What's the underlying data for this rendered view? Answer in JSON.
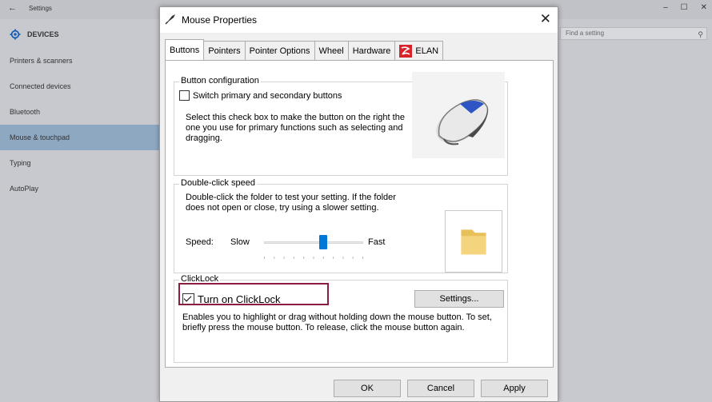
{
  "settings": {
    "title": "Settings",
    "category": "DEVICES",
    "search_placeholder": "Find a setting",
    "sidebar_items": [
      {
        "label": "Printers & scanners"
      },
      {
        "label": "Connected devices"
      },
      {
        "label": "Bluetooth"
      },
      {
        "label": "Mouse & touchpad",
        "active": true
      },
      {
        "label": "Typing"
      },
      {
        "label": "AutoPlay"
      }
    ]
  },
  "dialog": {
    "title": "Mouse Properties",
    "tabs": [
      "Buttons",
      "Pointers",
      "Pointer Options",
      "Wheel",
      "Hardware",
      "ELAN"
    ],
    "selected_tab": "Buttons",
    "button_config": {
      "legend": "Button configuration",
      "checkbox_label": "Switch primary and secondary buttons",
      "checked": false,
      "description": "Select this check box to make the button on the right the one you use for primary functions such as selecting and dragging."
    },
    "double_click": {
      "legend": "Double-click speed",
      "description": "Double-click the folder to test your setting. If the folder does not open or close, try using a slower setting.",
      "speed_label": "Speed:",
      "slow_label": "Slow",
      "fast_label": "Fast",
      "speed_value": 0.6
    },
    "clicklock": {
      "legend": "ClickLock",
      "checkbox_label": "Turn on ClickLock",
      "checked": true,
      "settings_button": "Settings...",
      "description": "Enables you to highlight or drag without holding down the mouse button. To set, briefly press the mouse button. To release, click the mouse button again."
    },
    "buttons": {
      "ok": "OK",
      "cancel": "Cancel",
      "apply": "Apply"
    }
  },
  "colors": {
    "accent": "#0078d7",
    "highlight": "#8b1e3f",
    "sidebar_active": "#8fa8c2"
  }
}
